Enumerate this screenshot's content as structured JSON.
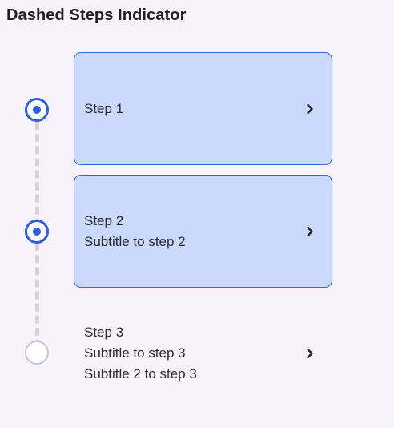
{
  "page": {
    "title": "Dashed Steps Indicator"
  },
  "colors": {
    "accent": "#2f5fe0",
    "selected_bg": "#cbdafa",
    "connector": "#d6d2dc",
    "inactive": "#c9c6cd"
  },
  "steps": [
    {
      "title": "Step 1",
      "subtitles": [],
      "state": "active",
      "icon": "chevron-right-icon"
    },
    {
      "title": "Step 2",
      "subtitles": [
        "Subtitle to step 2"
      ],
      "state": "active",
      "icon": "chevron-right-icon"
    },
    {
      "title": "Step 3",
      "subtitles": [
        "Subtitle to step 3",
        "Subtitle 2 to step 3"
      ],
      "state": "inactive",
      "icon": "chevron-right-icon"
    }
  ]
}
